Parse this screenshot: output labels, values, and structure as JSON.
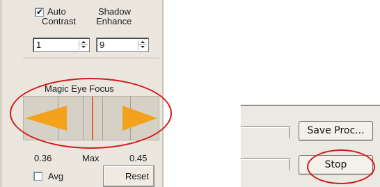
{
  "panel": {
    "auto_contrast": {
      "line1": "Auto",
      "line2": "Contrast",
      "checked": true
    },
    "shadow_enhance": {
      "line1": "Shadow",
      "line2": "Enhance"
    },
    "contrast_value": "1",
    "shadow_value": "9",
    "magic_eye_focus_label": "Magic Eye Focus",
    "left_value": "0.36",
    "center_label": "Max",
    "right_value": "0.45",
    "avg_label": "Avg",
    "avg_checked": false,
    "reset_label": "Reset"
  },
  "right": {
    "save_proc_label": "Save Proc...",
    "stop_label": "Stop"
  },
  "colors": {
    "arrow": "#f4a11c",
    "focus_line": "#e6612b",
    "highlight_ring": "#d11a1a"
  }
}
